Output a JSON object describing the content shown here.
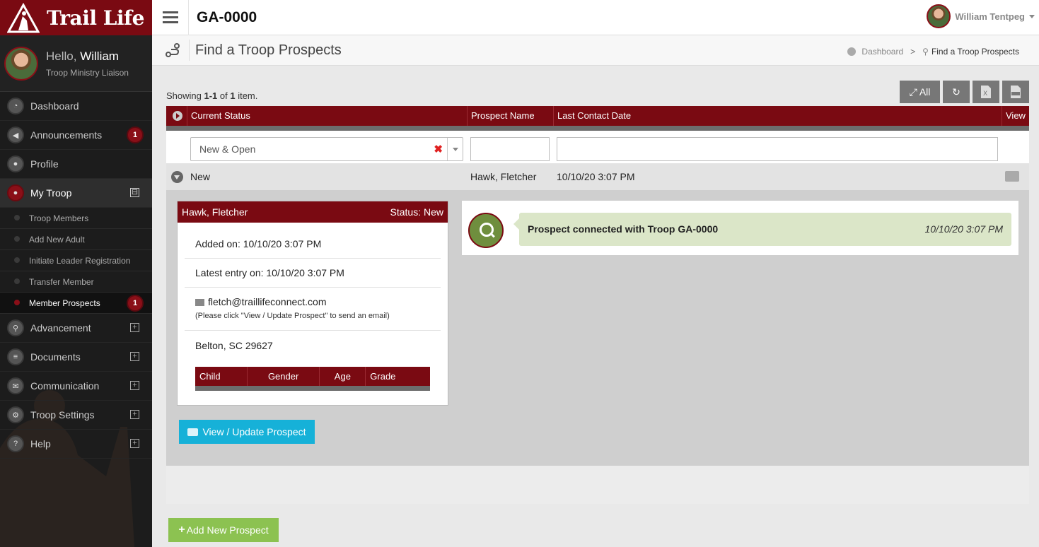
{
  "brand": {
    "name": "Trail Life",
    "accent": "#7a0a12"
  },
  "user": {
    "greeting": "Hello,",
    "first_name": "William",
    "role": "Troop Ministry Liaison",
    "full_name": "William Tentpeg"
  },
  "sidebar": {
    "items": [
      {
        "label": "Dashboard",
        "icon": "dashboard-icon"
      },
      {
        "label": "Announcements",
        "icon": "megaphone-icon",
        "badge": "1"
      },
      {
        "label": "Profile",
        "icon": "user-icon"
      },
      {
        "label": "My Troop",
        "icon": "group-icon",
        "toggle": "⊟"
      },
      {
        "label": "Advancement",
        "icon": "hiker-icon"
      },
      {
        "label": "Documents",
        "icon": "document-icon"
      },
      {
        "label": "Communication",
        "icon": "envelope-icon"
      },
      {
        "label": "Troop Settings",
        "icon": "gears-icon"
      },
      {
        "label": "Help",
        "icon": "question-icon"
      }
    ],
    "my_troop_sub": [
      {
        "label": "Troop Members"
      },
      {
        "label": "Add New Adult"
      },
      {
        "label": "Initiate Leader Registration"
      },
      {
        "label": "Transfer Member"
      },
      {
        "label": "Member Prospects",
        "badge": "1"
      }
    ]
  },
  "header": {
    "troop_code": "GA-0000"
  },
  "page": {
    "title": "Find a Troop Prospects",
    "breadcrumb": {
      "home": "Dashboard",
      "current": "Find a Troop Prospects",
      "separator": ">"
    }
  },
  "summary": {
    "prefix": "Showing ",
    "range": "1-1",
    "of": " of ",
    "total": "1",
    "suffix": " item."
  },
  "toolbar": {
    "expand_all_label": "All"
  },
  "grid": {
    "columns": [
      "Current Status",
      "Prospect Name",
      "Last Contact Date",
      "View"
    ],
    "filter": {
      "status_value": "New & Open",
      "clear_symbol": "✖"
    },
    "group": {
      "status": "New",
      "name": "Hawk, Fletcher",
      "date": "10/10/20 3:07 PM"
    }
  },
  "prospect_card": {
    "name": "Hawk, Fletcher",
    "status": "Status: New",
    "added": "Added on: 10/10/20 3:07 PM",
    "latest": "Latest entry on: 10/10/20 3:07 PM",
    "email": "fletch@traillifeconnect.com",
    "email_note": "(Please click \"View / Update Prospect\" to send an email)",
    "location": "Belton, SC 29627",
    "child_columns": [
      "Child",
      "Gender",
      "Age",
      "Grade"
    ]
  },
  "timeline": {
    "message": "Prospect connected with Troop GA-0000",
    "time": "10/10/20 3:07 PM"
  },
  "buttons": {
    "view_update": "View / Update Prospect",
    "add_new": "Add New Prospect"
  }
}
